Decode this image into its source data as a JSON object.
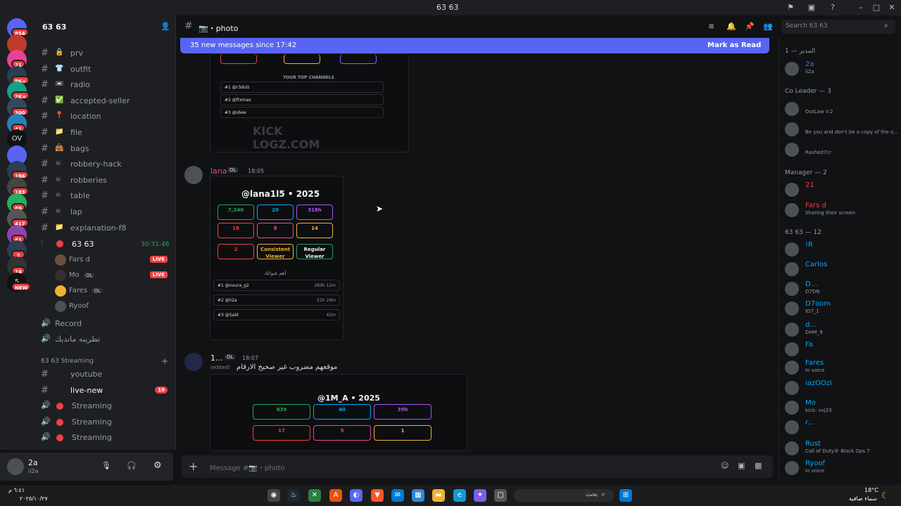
{
  "window": {
    "title": "63 63"
  },
  "servers": [
    {
      "label": "",
      "badge": "854"
    },
    {
      "label": "",
      "badge": ""
    },
    {
      "label": "",
      "badge": "21"
    },
    {
      "label": "",
      "badge": "9K+"
    },
    {
      "label": "",
      "badge": "2K+"
    },
    {
      "label": "",
      "badge": "300"
    },
    {
      "label": "",
      "badge": "41"
    },
    {
      "label": "OV",
      "badge": ""
    },
    {
      "label": "",
      "badge": ""
    },
    {
      "label": "",
      "badge": "186"
    },
    {
      "label": "",
      "badge": "183"
    },
    {
      "label": "",
      "badge": "69"
    },
    {
      "label": "",
      "badge": "417"
    },
    {
      "label": "",
      "badge": "61"
    },
    {
      "label": "",
      "badge": "2"
    },
    {
      "label": "",
      "badge": "14"
    },
    {
      "label": "5",
      "badge": "NEW"
    }
  ],
  "guild": {
    "name": "63 63"
  },
  "channels": [
    {
      "emoji": "🔒",
      "name": "prv"
    },
    {
      "emoji": "👕",
      "name": "outfit"
    },
    {
      "emoji": "📼",
      "name": "radio"
    },
    {
      "emoji": "✅",
      "name": "accepted-seller"
    },
    {
      "emoji": "📍",
      "name": "location"
    },
    {
      "emoji": "📁",
      "name": "file"
    },
    {
      "emoji": "👜",
      "name": "bags"
    },
    {
      "emoji": "☠",
      "name": "robbery-hack"
    },
    {
      "emoji": "☠",
      "name": "robberies"
    },
    {
      "emoji": "☠",
      "name": "table"
    },
    {
      "emoji": "☠",
      "name": "lap"
    },
    {
      "emoji": "📁",
      "name": "explanation-f8"
    }
  ],
  "voice_channel": {
    "name": "63 63",
    "timer": "30:31:46"
  },
  "voice_users": [
    {
      "name": "Fars d",
      "live": "LIVE"
    },
    {
      "name": "Mo",
      "tag": "OL",
      "live": "LIVE"
    },
    {
      "name": "Fares",
      "tag": "OL",
      "live": ""
    },
    {
      "name": "Ryoof",
      "live": ""
    }
  ],
  "other_channels": [
    {
      "name": "Record"
    },
    {
      "name": "تطرينه مانديك"
    }
  ],
  "category": {
    "name": "63 63 Streaming"
  },
  "streaming_channels": [
    {
      "name": "youtube",
      "badge": ""
    },
    {
      "name": "live-new",
      "badge": "19"
    },
    {
      "name": "Streaming",
      "badge": ""
    },
    {
      "name": "Streaming",
      "badge": ""
    },
    {
      "name": "Streaming",
      "badge": ""
    }
  ],
  "user_panel": {
    "name": "2a",
    "status": "ii2a"
  },
  "chat_header": {
    "channel": "📷・photo",
    "search_placeholder": "Search 63 63"
  },
  "new_messages": {
    "text": "35 new messages since 17:42",
    "action": "Mark as Read"
  },
  "embed1": {
    "heading": "YOUR TOP CHANNELS",
    "rows": [
      "#1 @r3dulz",
      "#2 @ftxmax",
      "#3 @idew"
    ],
    "brand": "KICK LOGZ.COM"
  },
  "message1": {
    "author": "lana",
    "tag": "OL",
    "time": "18:05"
  },
  "embed2": {
    "title": "@lana1l5 • 2025",
    "stats": [
      "7,340",
      "20",
      "318h",
      "18",
      "8",
      "14",
      "2",
      "Consistent Viewer",
      "Regular Viewer"
    ],
    "section": "أهم قنواتك",
    "rows": [
      {
        "name": "#1 @noura_g2",
        "val": "283h 12m"
      },
      {
        "name": "#2 @ii2a",
        "val": "51h 24m"
      },
      {
        "name": "#3 @Sald",
        "val": "42m"
      }
    ]
  },
  "message2": {
    "author": "1...",
    "tag": "OL",
    "time": "18:07",
    "text": "موقعهم مضروب غير صحيح الارقام",
    "edited": "(edited)"
  },
  "embed3": {
    "title": "@1M_A • 2025",
    "stats": [
      "839",
      "40",
      "39h",
      "17",
      "5",
      "1"
    ]
  },
  "composer": {
    "placeholder": "Message #📷・photo"
  },
  "members": {
    "groups": [
      {
        "title": "المدير — 1",
        "items": [
          {
            "name": "2a",
            "status": "ii2a",
            "color": "#5865f2"
          }
        ]
      },
      {
        "title": "Co Leader — 3",
        "items": [
          {
            "name": "",
            "status": "OutLaw V.2",
            "color": "#dbdee1"
          },
          {
            "name": "",
            "status": "Be you and don't be a copy of the o...",
            "color": "#dbdee1"
          },
          {
            "name": "",
            "status": "Rashed7cr",
            "color": "#dbdee1"
          }
        ]
      },
      {
        "title": "Manager — 2",
        "items": [
          {
            "name": "21",
            "status": "",
            "color": "#f23f43"
          },
          {
            "name": "Fars d",
            "status": "Sharing their screen",
            "color": "#f23f43"
          }
        ]
      },
      {
        "title": "63 63 — 12",
        "items": [
          {
            "name": "!R",
            "status": "",
            "color": "#00a8fc"
          },
          {
            "name": "Carlos",
            "status": "",
            "color": "#00a8fc"
          },
          {
            "name": "D...",
            "status": "D7DN",
            "color": "#00a8fc"
          },
          {
            "name": "D7oom",
            "status": "ID7_1",
            "color": "#00a8fc"
          },
          {
            "name": "d...",
            "status": "DHM_9",
            "color": "#00a8fc"
          },
          {
            "name": "Fa",
            "status": "",
            "color": "#00a8fc"
          },
          {
            "name": "Fares",
            "status": "In voice",
            "color": "#00a8fc"
          },
          {
            "name": "iazOOzi",
            "status": "",
            "color": "#00a8fc"
          },
          {
            "name": "Mo",
            "status": "kick: vvj23",
            "color": "#00a8fc"
          },
          {
            "name": "r...",
            "status": "",
            "color": "#00a8fc"
          },
          {
            "name": "Rust",
            "status": "Call of Duty® Black Ops 7",
            "color": "#00a8fc"
          },
          {
            "name": "Ryoof",
            "status": "In voice",
            "color": "#00a8fc"
          }
        ]
      }
    ]
  },
  "taskbar": {
    "search_placeholder": "بحث",
    "weather_temp": "18°C",
    "weather_text": "سماء صافية",
    "date": "٢٠٢٥/١٠/٢٧",
    "time": "٦:٤١ م"
  }
}
